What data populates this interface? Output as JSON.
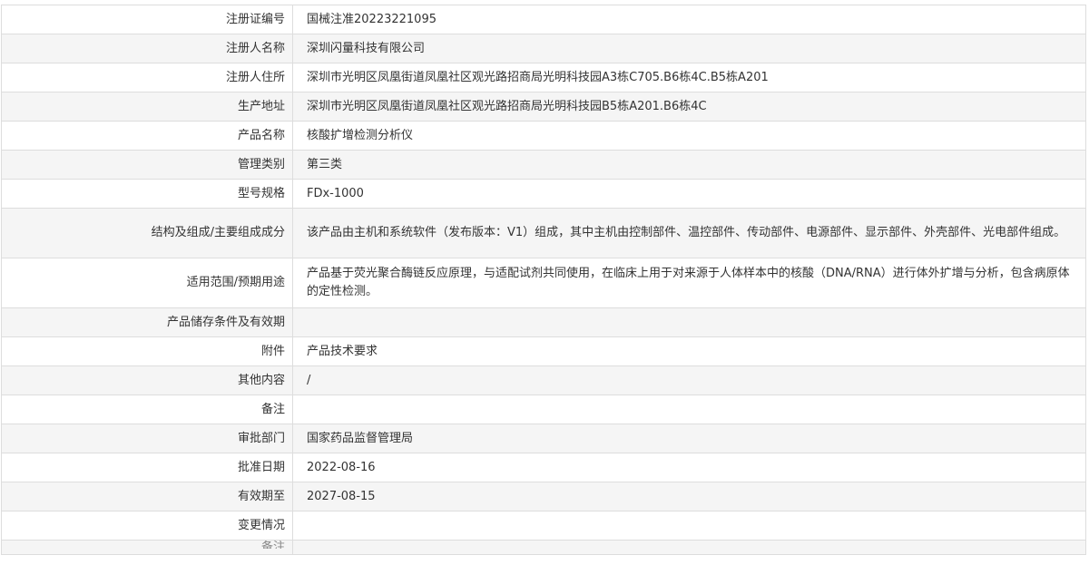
{
  "rows": [
    {
      "label": "注册证编号",
      "value": "国械注准20223221095"
    },
    {
      "label": "注册人名称",
      "value": "深圳闪量科技有限公司"
    },
    {
      "label": "注册人住所",
      "value": "深圳市光明区凤凰街道凤凰社区观光路招商局光明科技园A3栋C705.B6栋4C.B5栋A201"
    },
    {
      "label": "生产地址",
      "value": "深圳市光明区凤凰街道凤凰社区观光路招商局光明科技园B5栋A201.B6栋4C"
    },
    {
      "label": "产品名称",
      "value": "核酸扩增检测分析仪"
    },
    {
      "label": "管理类别",
      "value": "第三类"
    },
    {
      "label": "型号规格",
      "value": "FDx-1000"
    },
    {
      "label": "结构及组成/主要组成成分",
      "value": "该产品由主机和系统软件（发布版本：V1）组成，其中主机由控制部件、温控部件、传动部件、电源部件、显示部件、外壳部件、光电部件组成。"
    },
    {
      "label": "适用范围/预期用途",
      "value": "产品基于荧光聚合酶链反应原理，与适配试剂共同使用，在临床上用于对来源于人体样本中的核酸（DNA/RNA）进行体外扩增与分析，包含病原体的定性检测。"
    },
    {
      "label": "产品储存条件及有效期",
      "value": ""
    },
    {
      "label": "附件",
      "value": "产品技术要求"
    },
    {
      "label": "其他内容",
      "value": "/"
    },
    {
      "label": "备注",
      "value": ""
    },
    {
      "label": "审批部门",
      "value": "国家药品监督管理局"
    },
    {
      "label": "批准日期",
      "value": "2022-08-16"
    },
    {
      "label": "有效期至",
      "value": "2027-08-15"
    },
    {
      "label": "变更情况",
      "value": ""
    },
    {
      "label": "备注",
      "value": ""
    }
  ]
}
